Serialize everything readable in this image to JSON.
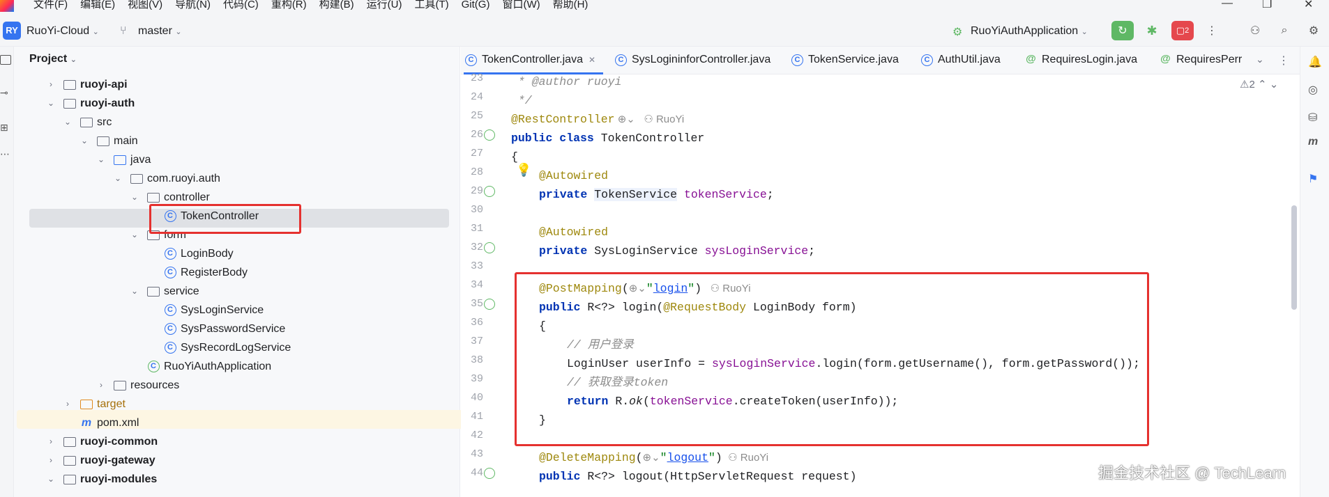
{
  "menubar": {
    "items": [
      "文件(F)",
      "编辑(E)",
      "视图(V)",
      "导航(N)",
      "代码(C)",
      "重构(R)",
      "构建(B)",
      "运行(U)",
      "工具(T)",
      "Git(G)",
      "窗口(W)",
      "帮助(H)"
    ]
  },
  "toolbar": {
    "project_badge": "RY",
    "project_name": "RuoYi-Cloud",
    "branch": "master",
    "run_config": "RuoYiAuthApplication",
    "stop_count": "2"
  },
  "project_panel": {
    "title": "Project",
    "tree": [
      {
        "label": "ruoyi-api",
        "bold": true
      },
      {
        "label": "ruoyi-auth",
        "bold": true
      },
      {
        "label": "src",
        "bold": false
      },
      {
        "label": "main",
        "bold": false
      },
      {
        "label": "java",
        "bold": false
      },
      {
        "label": "com.ruoyi.auth",
        "bold": false
      },
      {
        "label": "controller",
        "bold": false
      },
      {
        "label": "TokenController",
        "bold": false
      },
      {
        "label": "form",
        "bold": false
      },
      {
        "label": "LoginBody",
        "bold": false
      },
      {
        "label": "RegisterBody",
        "bold": false
      },
      {
        "label": "service",
        "bold": false
      },
      {
        "label": "SysLoginService",
        "bold": false
      },
      {
        "label": "SysPasswordService",
        "bold": false
      },
      {
        "label": "SysRecordLogService",
        "bold": false
      },
      {
        "label": "RuoYiAuthApplication",
        "bold": false
      },
      {
        "label": "resources",
        "bold": false
      },
      {
        "label": "target",
        "bold": false
      },
      {
        "label": "pom.xml",
        "bold": false
      },
      {
        "label": "ruoyi-common",
        "bold": true
      },
      {
        "label": "ruoyi-gateway",
        "bold": true
      },
      {
        "label": "ruoyi-modules",
        "bold": true
      }
    ]
  },
  "tabs": [
    {
      "label": "TokenController.java",
      "active": true
    },
    {
      "label": "SysLogininforController.java",
      "active": false
    },
    {
      "label": "TokenService.java",
      "active": false
    },
    {
      "label": "AuthUtil.java",
      "active": false
    },
    {
      "label": "RequiresLogin.java",
      "active": false
    },
    {
      "label": "RequiresPerr",
      "active": false
    }
  ],
  "editor": {
    "warnings": "2",
    "line_numbers": [
      "23",
      "24",
      "25",
      "26",
      "27",
      "28",
      "29",
      "30",
      "31",
      "32",
      "33",
      "34",
      "35",
      "36",
      "37",
      "38",
      "39",
      "40",
      "41",
      "42",
      "43",
      "44"
    ],
    "author_hint": "RuoYi",
    "code": {
      "l23": " * @author ruoyi",
      "l24": " */",
      "l25_ann": "@RestController",
      "l26_kw": "public class",
      "l26_name": " TokenController",
      "l27": "{",
      "l28_ann": "@Autowired",
      "l29_kw": "private",
      "l29_type": "TokenService",
      "l29_field": "tokenService",
      "l31_ann": "@Autowired",
      "l32_kw": "private",
      "l32_type": " SysLoginService ",
      "l32_field": "sysLoginService",
      "l34_ann": "@PostMapping",
      "l34_val": "login",
      "l35_kw": "public",
      "l35_a": " R<?> login(",
      "l35_ann": "@RequestBody",
      "l35_b": " LoginBody form)",
      "l36": "{",
      "l37": "// 用户登录",
      "l38_a": "LoginUser userInfo = ",
      "l38_field": "sysLoginService",
      "l38_b": ".login(form.getUsername(), form.getPassword());",
      "l39": "// 获取登录token",
      "l40_kw": "return",
      "l40_a": " R.",
      "l40_ok": "ok",
      "l40_b": "(",
      "l40_field": "tokenService",
      "l40_c": ".createToken(userInfo));",
      "l41": "}",
      "l43_ann": "@DeleteMapping",
      "l43_val": "logout",
      "l44_kw": "public",
      "l44_a": " R<?> logout(HttpServletRequest request)"
    }
  },
  "watermark": "掘金技术社区 @ TechLearn"
}
